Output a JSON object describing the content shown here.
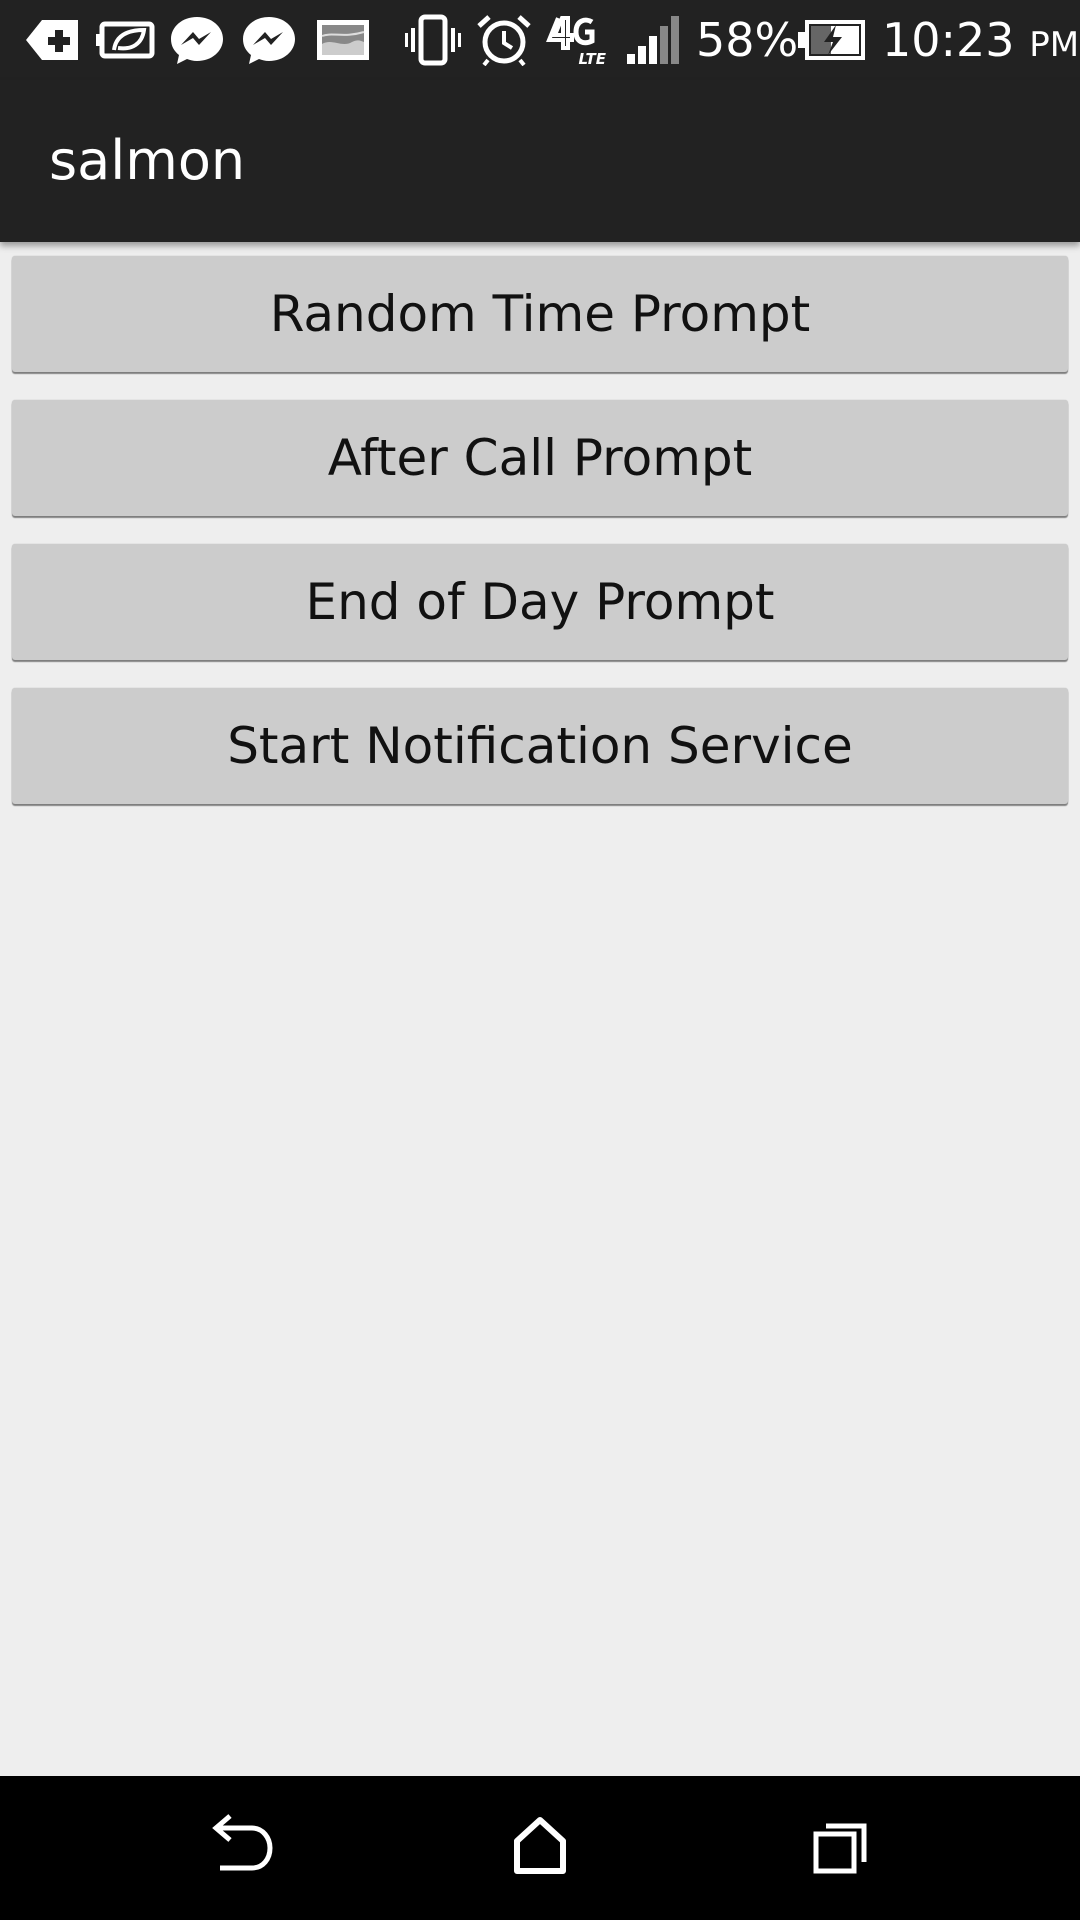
{
  "status_bar": {
    "icons": [
      "add-notification-icon",
      "leaf-battery-icon",
      "messenger-icon",
      "messenger-icon",
      "image-icon",
      "vibrate-icon",
      "alarm-icon",
      "4g-lte-icon",
      "signal-icon",
      "battery-charging-icon"
    ],
    "battery_percent": "58%",
    "time": "10:23",
    "ampm": "PM"
  },
  "app_bar": {
    "title": "salmon"
  },
  "buttons": {
    "random_time": "Random Time Prompt",
    "after_call": "After Call Prompt",
    "end_of_day": "End of Day Prompt",
    "start_notification": "Start Notification Service"
  },
  "nav_bar": {
    "icons": [
      "back-icon",
      "home-icon",
      "recents-icon"
    ]
  },
  "colors": {
    "bar_background": "#222222",
    "page_background": "#eeeeee",
    "button_background": "#cccccc",
    "nav_background": "#000000"
  }
}
